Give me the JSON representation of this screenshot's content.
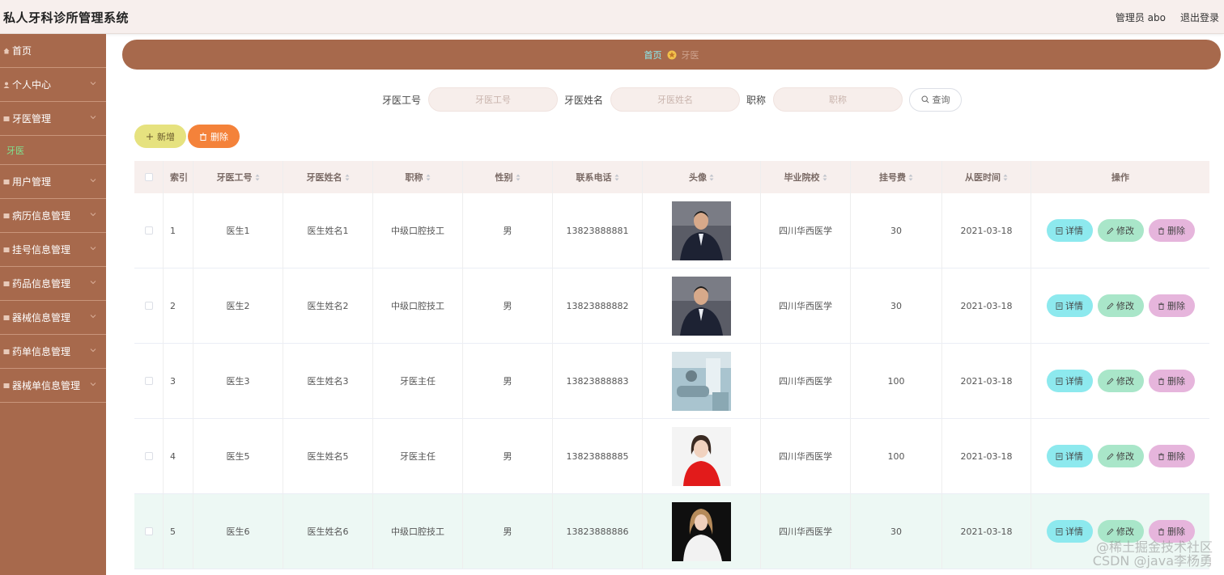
{
  "app": {
    "title": "私人牙科诊所管理系统"
  },
  "topbar": {
    "user": "管理员 abo",
    "logout": "退出登录"
  },
  "sidebar": {
    "items": [
      {
        "label": "首页",
        "icon": "home-icon",
        "expandable": false
      },
      {
        "label": "个人中心",
        "icon": "user-icon",
        "expandable": true
      },
      {
        "label": "牙医管理",
        "icon": "menu-icon",
        "expandable": true
      },
      {
        "label": "用户管理",
        "icon": "menu-icon",
        "expandable": true
      },
      {
        "label": "病历信息管理",
        "icon": "menu-icon",
        "expandable": true
      },
      {
        "label": "挂号信息管理",
        "icon": "menu-icon",
        "expandable": true
      },
      {
        "label": "药品信息管理",
        "icon": "menu-icon",
        "expandable": true
      },
      {
        "label": "器械信息管理",
        "icon": "menu-icon",
        "expandable": true
      },
      {
        "label": "药单信息管理",
        "icon": "menu-icon",
        "expandable": true
      },
      {
        "label": "器械单信息管理",
        "icon": "menu-icon",
        "expandable": true
      }
    ],
    "active_sub": "牙医"
  },
  "breadcrumb": {
    "home": "首页",
    "current": "牙医"
  },
  "search": {
    "fields": [
      {
        "label": "牙医工号",
        "placeholder": "牙医工号"
      },
      {
        "label": "牙医姓名",
        "placeholder": "牙医姓名"
      },
      {
        "label": "职称",
        "placeholder": "职称"
      }
    ],
    "query_label": "查询"
  },
  "actions": {
    "add_label": "新增",
    "delete_label": "删除"
  },
  "table": {
    "headers": {
      "index": "索引",
      "id": "牙医工号",
      "name": "牙医姓名",
      "title": "职称",
      "sex": "性别",
      "phone": "联系电话",
      "avatar": "头像",
      "school": "毕业院校",
      "fee": "挂号费",
      "date": "从医时间",
      "ops": "操作"
    },
    "rows": [
      {
        "index": "1",
        "id": "医生1",
        "name": "医生姓名1",
        "title": "中级口腔技工",
        "sex": "男",
        "phone": "13823888881",
        "avatar": "man-suit",
        "school": "四川华西医学",
        "fee": "30",
        "date": "2021-03-18"
      },
      {
        "index": "2",
        "id": "医生2",
        "name": "医生姓名2",
        "title": "中级口腔技工",
        "sex": "男",
        "phone": "13823888882",
        "avatar": "man-suit",
        "school": "四川华西医学",
        "fee": "30",
        "date": "2021-03-18"
      },
      {
        "index": "3",
        "id": "医生3",
        "name": "医生姓名3",
        "title": "牙医主任",
        "sex": "男",
        "phone": "13823888883",
        "avatar": "dental-clinic",
        "school": "四川华西医学",
        "fee": "100",
        "date": "2021-03-18"
      },
      {
        "index": "4",
        "id": "医生5",
        "name": "医生姓名5",
        "title": "牙医主任",
        "sex": "男",
        "phone": "13823888885",
        "avatar": "woman-red",
        "school": "四川华西医学",
        "fee": "100",
        "date": "2021-03-18"
      },
      {
        "index": "5",
        "id": "医生6",
        "name": "医生姓名6",
        "title": "中级口腔技工",
        "sex": "男",
        "phone": "13823888886",
        "avatar": "woman-white",
        "school": "四川华西医学",
        "fee": "30",
        "date": "2021-03-18"
      }
    ],
    "op_labels": {
      "detail": "详情",
      "edit": "修改",
      "delete": "删除"
    }
  },
  "watermark": {
    "line1": "@稀土掘金技术社区",
    "line2": "CSDN @java李杨勇"
  },
  "colors": {
    "sidebar": "#a7694c",
    "topbar": "#f7efed",
    "add_button": "#e6e27f",
    "delete_button": "#f4823a",
    "detail_button": "#8de9ee",
    "edit_button": "#a9e6c9",
    "row_delete_button": "#e6b5dc"
  }
}
